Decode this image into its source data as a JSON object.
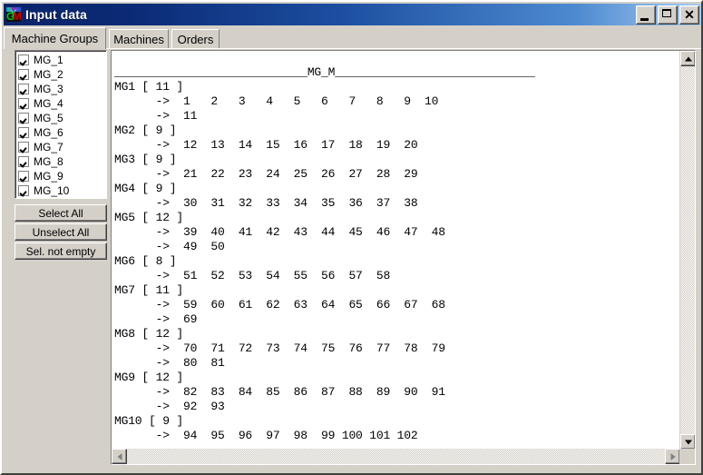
{
  "window": {
    "title": "Input data",
    "icon": "app-logo-icon",
    "controls": {
      "minimize": "minimize-icon",
      "maximize": "maximize-icon",
      "close": "close-icon"
    }
  },
  "tabs": [
    {
      "label": "Machine Groups",
      "active": true
    },
    {
      "label": "Machines",
      "active": false
    },
    {
      "label": "Orders",
      "active": false
    }
  ],
  "sidebar": {
    "items": [
      {
        "label": "MG_1",
        "checked": true
      },
      {
        "label": "MG_2",
        "checked": true
      },
      {
        "label": "MG_3",
        "checked": true
      },
      {
        "label": "MG_4",
        "checked": true
      },
      {
        "label": "MG_5",
        "checked": true
      },
      {
        "label": "MG_6",
        "checked": true
      },
      {
        "label": "MG_7",
        "checked": true
      },
      {
        "label": "MG_8",
        "checked": true
      },
      {
        "label": "MG_9",
        "checked": true
      },
      {
        "label": "MG_10",
        "checked": true
      }
    ],
    "buttons": [
      {
        "label": "Select All"
      },
      {
        "label": "Unselect All"
      },
      {
        "label": "Sel. not empty"
      }
    ]
  },
  "report": {
    "header_label": "MG_M",
    "groups": [
      {
        "name": "MG1",
        "count": 11,
        "rows": [
          [
            1,
            2,
            3,
            4,
            5,
            6,
            7,
            8,
            9,
            10
          ],
          [
            11
          ]
        ]
      },
      {
        "name": "MG2",
        "count": 9,
        "rows": [
          [
            12,
            13,
            14,
            15,
            16,
            17,
            18,
            19,
            20
          ]
        ]
      },
      {
        "name": "MG3",
        "count": 9,
        "rows": [
          [
            21,
            22,
            23,
            24,
            25,
            26,
            27,
            28,
            29
          ]
        ]
      },
      {
        "name": "MG4",
        "count": 9,
        "rows": [
          [
            30,
            31,
            32,
            33,
            34,
            35,
            36,
            37,
            38
          ]
        ]
      },
      {
        "name": "MG5",
        "count": 12,
        "rows": [
          [
            39,
            40,
            41,
            42,
            43,
            44,
            45,
            46,
            47,
            48
          ],
          [
            49,
            50
          ]
        ]
      },
      {
        "name": "MG6",
        "count": 8,
        "rows": [
          [
            51,
            52,
            53,
            54,
            55,
            56,
            57,
            58
          ]
        ]
      },
      {
        "name": "MG7",
        "count": 11,
        "rows": [
          [
            59,
            60,
            61,
            62,
            63,
            64,
            65,
            66,
            67,
            68
          ],
          [
            69
          ]
        ]
      },
      {
        "name": "MG8",
        "count": 12,
        "rows": [
          [
            70,
            71,
            72,
            73,
            74,
            75,
            76,
            77,
            78,
            79
          ],
          [
            80,
            81
          ]
        ]
      },
      {
        "name": "MG9",
        "count": 12,
        "rows": [
          [
            82,
            83,
            84,
            85,
            86,
            87,
            88,
            89,
            90,
            91
          ],
          [
            92,
            93
          ]
        ]
      },
      {
        "name": "MG10",
        "count": 9,
        "rows": [
          [
            94,
            95,
            96,
            97,
            98,
            99,
            100,
            101,
            102
          ]
        ]
      }
    ],
    "arrow_marker": "->"
  },
  "scrollbars": {
    "vertical": {
      "up": "scroll-up-arrow-icon",
      "down": "scroll-down-arrow-icon"
    },
    "horizontal": {
      "left": "scroll-left-arrow-icon",
      "right": "scroll-right-arrow-icon"
    }
  },
  "colors": {
    "title_start": "#0a246a",
    "title_end": "#a6caf0",
    "face": "#d4d0c8",
    "text": "#000000",
    "field": "#ffffff"
  }
}
